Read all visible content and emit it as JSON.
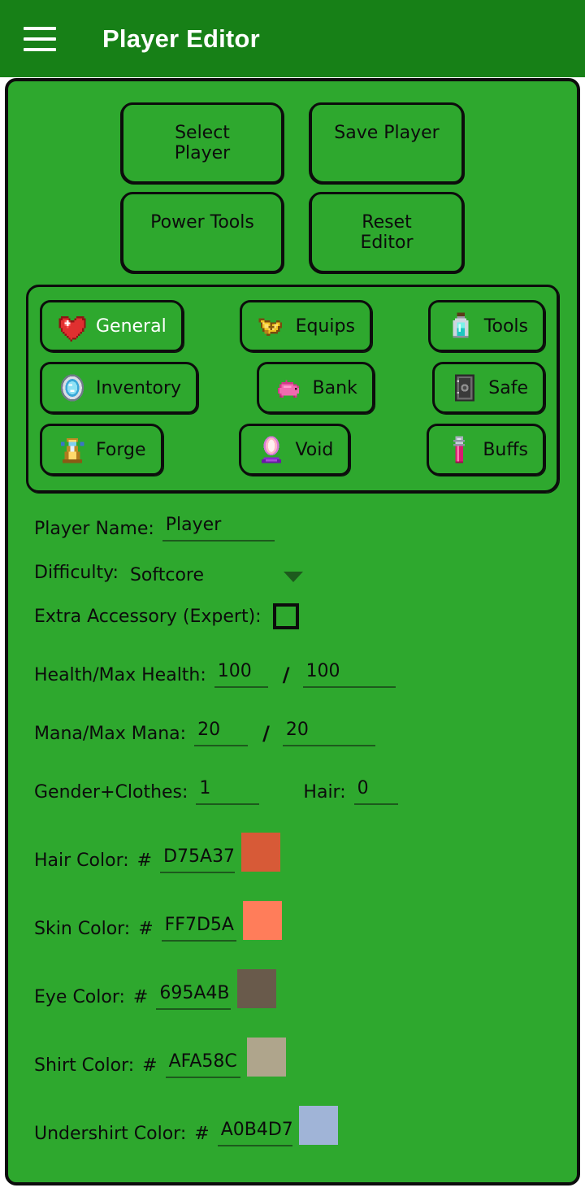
{
  "appbar": {
    "menu_icon": "hamburger-menu-icon",
    "title": "Player Editor",
    "background": "#178017"
  },
  "theme": {
    "background": "#2EA82E",
    "border": "#0C0C0C",
    "underline": "#1D5A1D",
    "selected_text": "#FFFFFF",
    "text": "#0C0C0C"
  },
  "top_buttons": [
    {
      "label": "Select Player"
    },
    {
      "label": "Save Player"
    },
    {
      "label": "Power Tools"
    },
    {
      "label": "Reset Editor"
    }
  ],
  "tabs": [
    {
      "label": "General",
      "icon": "heart-icon",
      "selected": true
    },
    {
      "label": "Equips",
      "icon": "helmet-icon",
      "selected": false
    },
    {
      "label": "Tools",
      "icon": "bottle-icon",
      "selected": false
    },
    {
      "label": "Inventory",
      "icon": "mirror-icon",
      "selected": false
    },
    {
      "label": "Bank",
      "icon": "piggybank-icon",
      "selected": false
    },
    {
      "label": "Safe",
      "icon": "vault-icon",
      "selected": false
    },
    {
      "label": "Forge",
      "icon": "forge-icon",
      "selected": false
    },
    {
      "label": "Void",
      "icon": "crystal-icon",
      "selected": false
    },
    {
      "label": "Buffs",
      "icon": "potion-icon",
      "selected": false
    }
  ],
  "form": {
    "player_name_label": "Player Name:",
    "player_name_value": "Player",
    "difficulty_label": "Difficulty:",
    "difficulty_value": "Softcore",
    "difficulty_options": [
      "Softcore"
    ],
    "extra_accessory_label": "Extra Accessory (Expert):",
    "extra_accessory_checked": false,
    "health_label": "Health/Max Health:",
    "health_value": "100",
    "max_health_value": "100",
    "mana_label": "Mana/Max Mana:",
    "mana_value": "20",
    "max_mana_value": "20",
    "gender_label": "Gender+Clothes:",
    "gender_value": "1",
    "hair_label": "Hair:",
    "hair_value": "0",
    "separator": "/",
    "hash": "#"
  },
  "colors": [
    {
      "label": "Hair Color:",
      "hex": "D75A37",
      "swatch": "#D75A37"
    },
    {
      "label": "Skin Color:",
      "hex": "FF7D5A",
      "swatch": "#FF7D5A"
    },
    {
      "label": "Eye Color:",
      "hex": "695A4B",
      "swatch": "#695A4B"
    },
    {
      "label": "Shirt Color:",
      "hex": "AFA58C",
      "swatch": "#AFA58C"
    },
    {
      "label": "Undershirt Color:",
      "hex": "A0B4D7",
      "swatch": "#A0B4D7"
    }
  ]
}
